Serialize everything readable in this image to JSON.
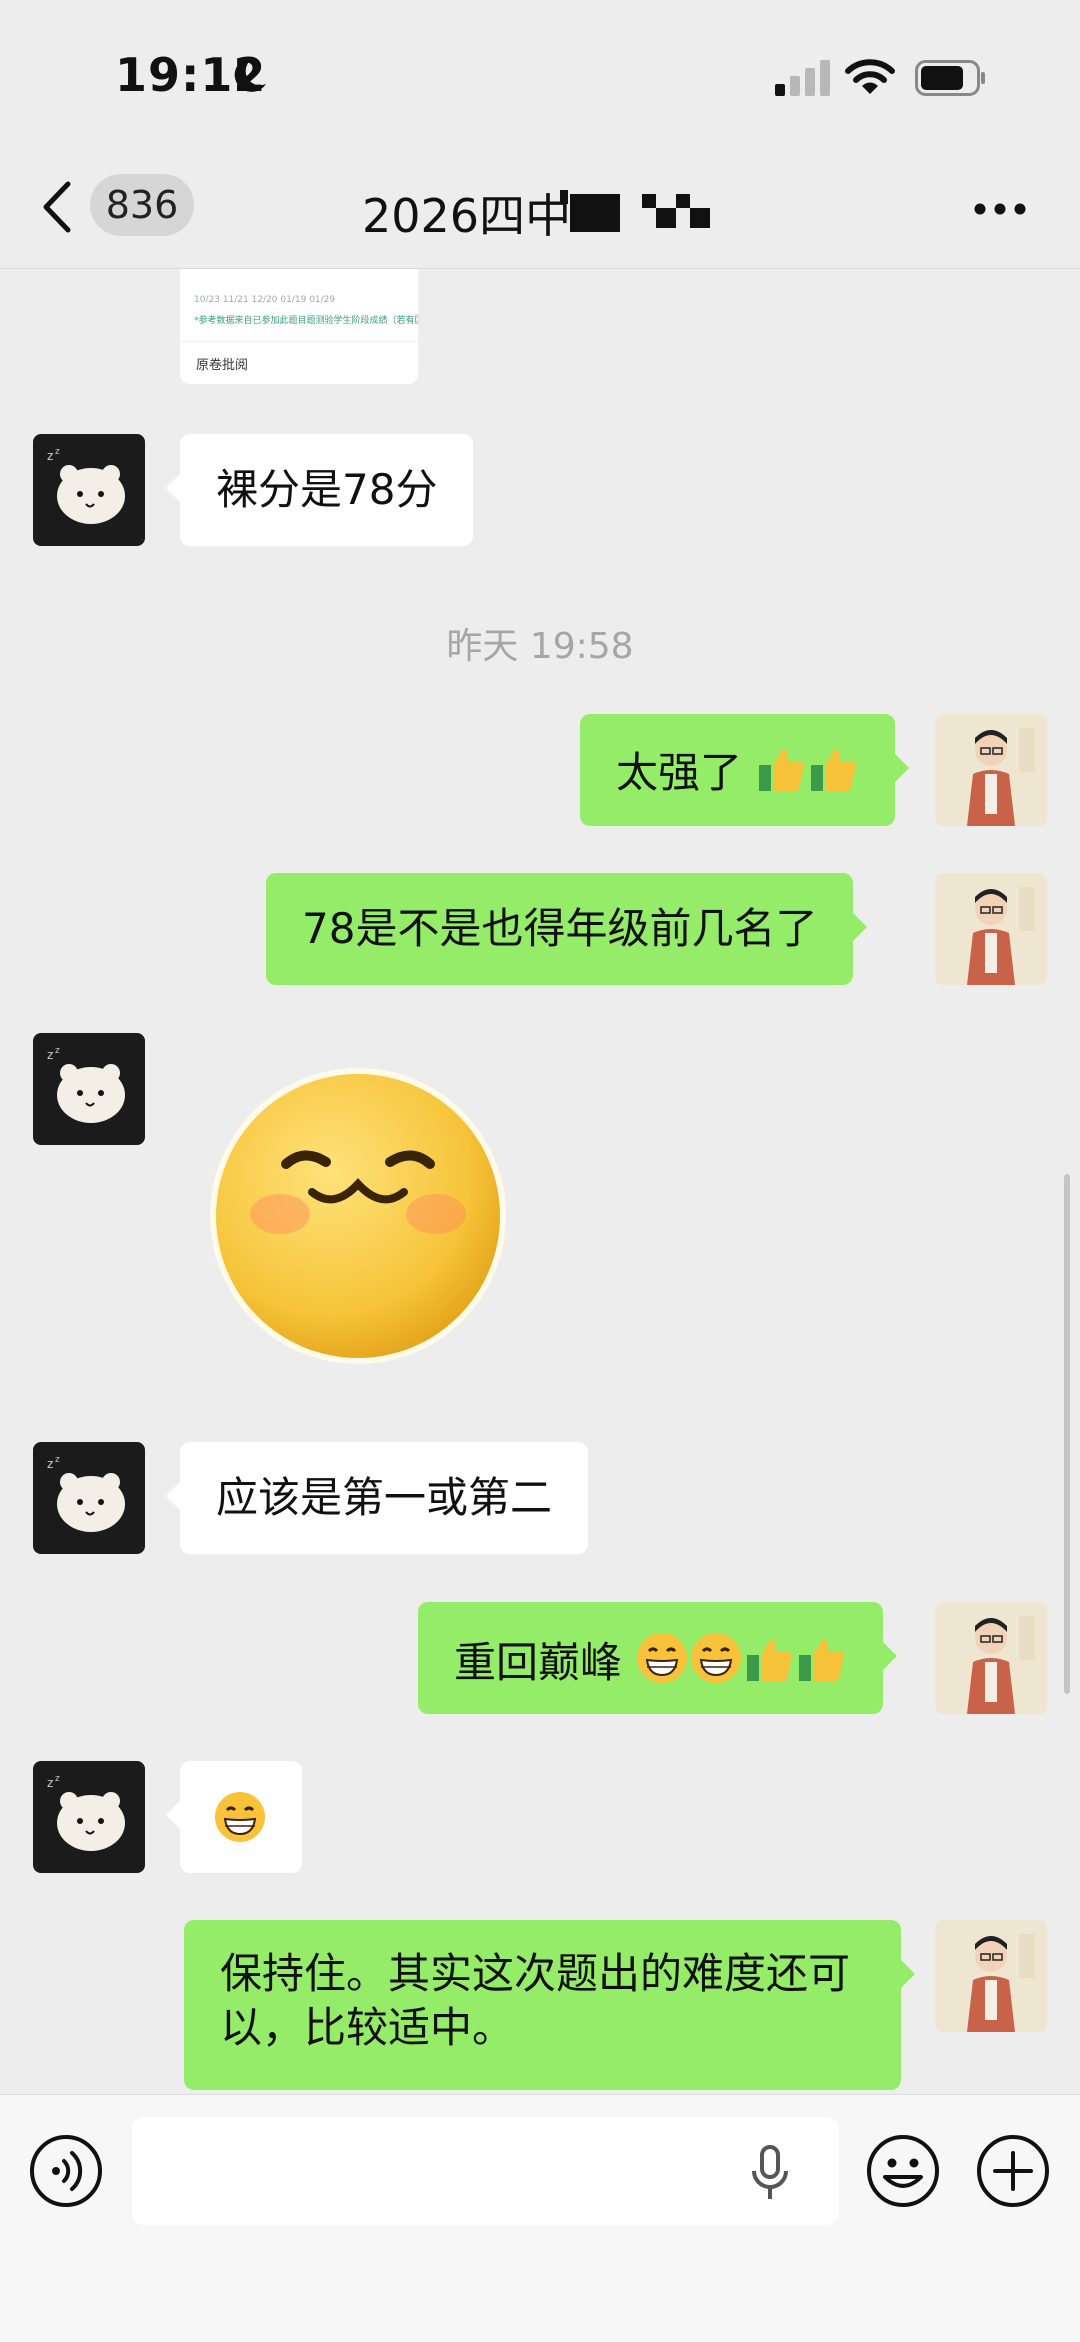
{
  "status_bar": {
    "time": "19:12"
  },
  "nav": {
    "unread_count": "836",
    "title": "2026四中"
  },
  "preview_card": {
    "dates": "10/23      11/21      12/20      01/19      01/29",
    "note": "*参考数据来自已参加此题目题测验学生阶段成绩（若有区间）",
    "label": "原卷批阅"
  },
  "messages": {
    "m1": "裸分是78分",
    "timestamp": "昨天 19:58",
    "m2": "太强了",
    "m3": "78是不是也得年级前几名了",
    "m5": "应该是第一或第二",
    "m6": "重回巅峰",
    "m8": "保持住。其实这次题出的难度还可以，比较适中。"
  },
  "colors": {
    "bubble_outgoing": "#95ec69",
    "bubble_incoming": "#ffffff",
    "background": "#ededed"
  },
  "icons": {
    "back": "chevron-left-icon",
    "more": "more-dots-icon",
    "voice": "voice-icon",
    "mic": "microphone-icon",
    "emoji": "emoji-icon",
    "add": "plus-icon"
  }
}
